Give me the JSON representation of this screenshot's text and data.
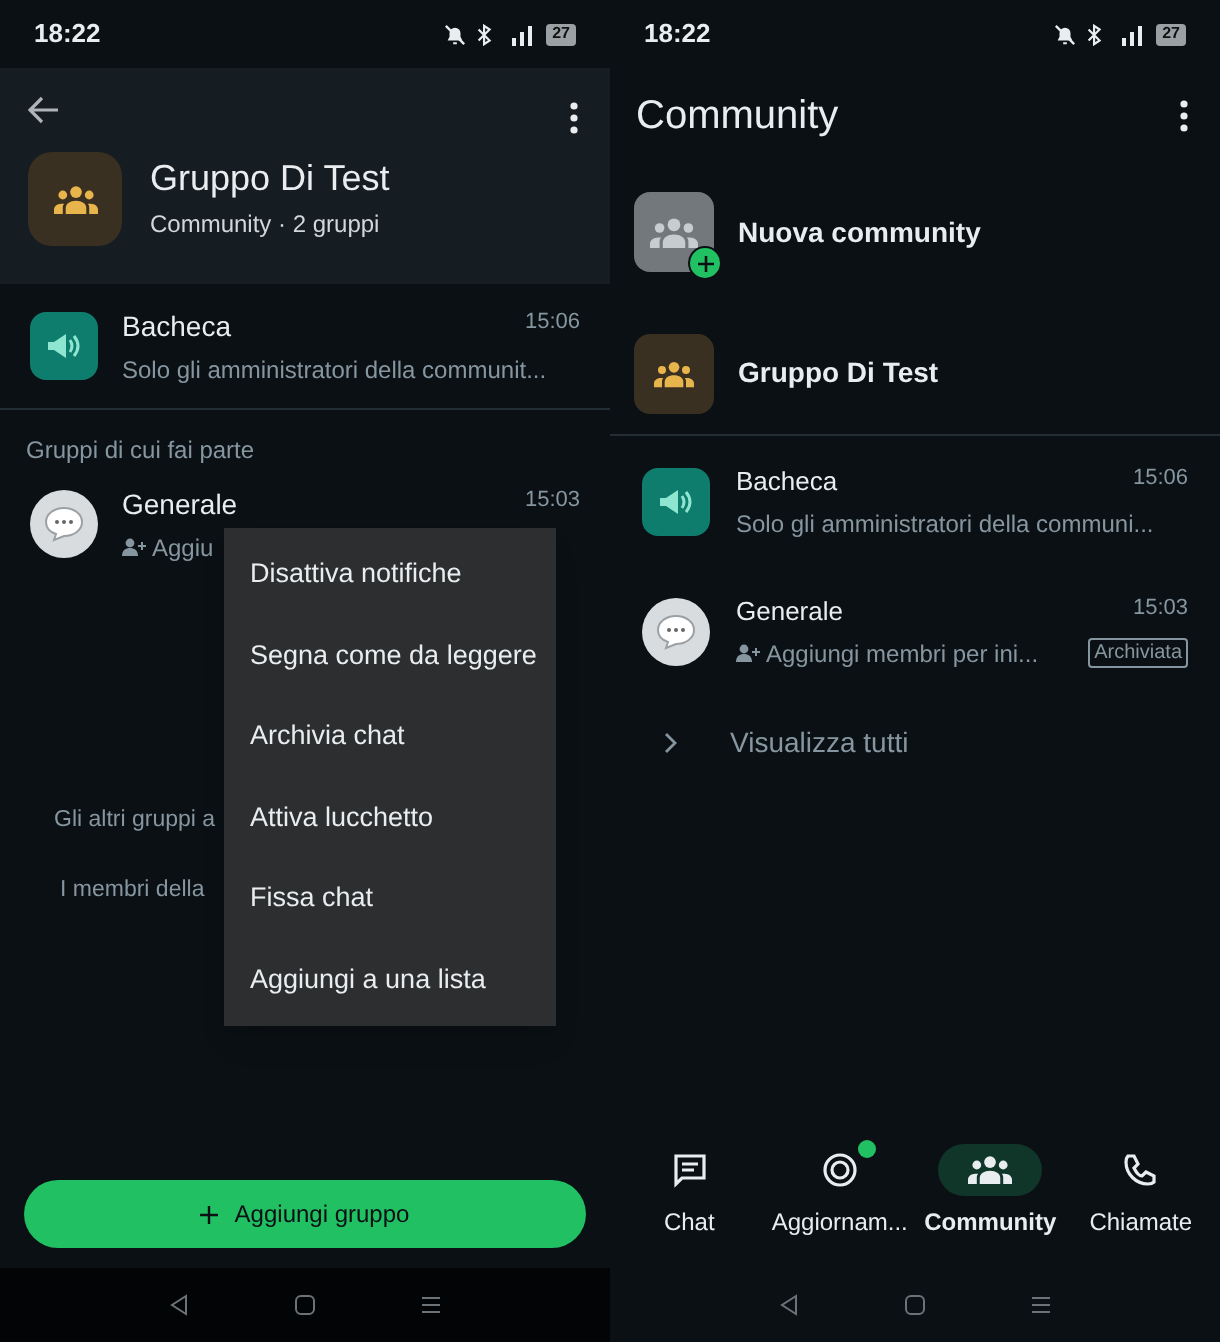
{
  "left": {
    "status_bar": {
      "time": "18:22",
      "battery": "27"
    },
    "header": {
      "title": "Gruppo Di Test",
      "subtitle": "Community · 2 gruppi"
    },
    "announcement": {
      "name": "Bacheca",
      "time": "15:06",
      "preview": "Solo gli amministratori della communit..."
    },
    "section_label": "Gruppi di cui fai parte",
    "group": {
      "name": "Generale",
      "time": "15:03",
      "preview": "Aggiu"
    },
    "info_lines": [
      "Gli altri gruppi a",
      "I membri della"
    ],
    "context_menu": [
      "Disattiva notifiche",
      "Segna come da leggere",
      "Archivia chat",
      "Attiva lucchetto",
      "Fissa chat",
      "Aggiungi a una lista"
    ],
    "add_button": "Aggiungi gruppo"
  },
  "right": {
    "status_bar": {
      "time": "18:22",
      "battery": "27"
    },
    "title": "Community",
    "new_community": "Nuova community",
    "community": "Gruppo Di Test",
    "chats": [
      {
        "kind": "announcement",
        "name": "Bacheca",
        "time": "15:06",
        "preview": "Solo gli amministratori della communi..."
      },
      {
        "kind": "group",
        "name": "Generale",
        "time": "15:03",
        "preview": "Aggiungi membri per ini...",
        "badge": "Archiviata"
      }
    ],
    "view_all": "Visualizza tutti",
    "tabs": [
      {
        "label": "Chat",
        "selected": false,
        "unread": false
      },
      {
        "label": "Aggiornam...",
        "selected": false,
        "unread": true
      },
      {
        "label": "Community",
        "selected": true,
        "unread": false
      },
      {
        "label": "Chiamate",
        "selected": false,
        "unread": false
      }
    ]
  }
}
